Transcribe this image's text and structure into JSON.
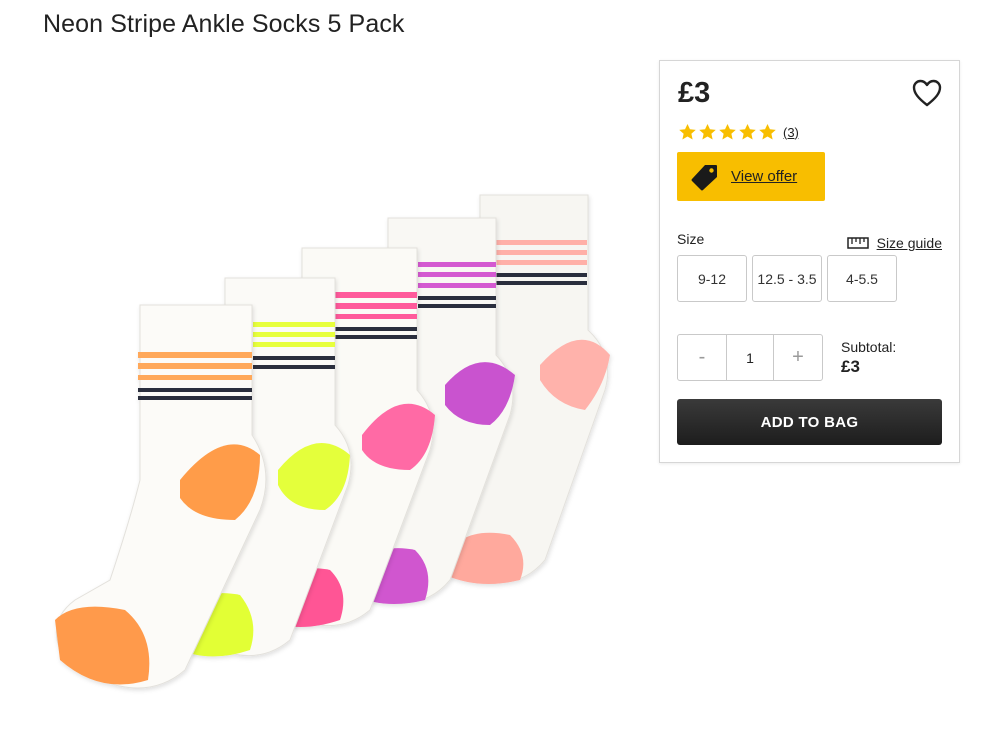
{
  "product": {
    "title": "Neon Stripe Ankle Socks 5 Pack",
    "image_icon": "socks-5pack-image"
  },
  "panel": {
    "price": "£3",
    "wishlist_icon": "heart-outline-icon",
    "rating": {
      "stars": 5,
      "max": 5,
      "count_label": "(3)",
      "star_color": "#f8be00"
    },
    "offer": {
      "icon": "price-tag-icon",
      "label": "View offer",
      "color": "#f8be00"
    },
    "size": {
      "label": "Size",
      "guide_icon": "ruler-icon",
      "guide_label": "Size guide",
      "options": [
        "9-12",
        "12.5 - 3.5",
        "4-5.5"
      ]
    },
    "quantity": {
      "minus": "-",
      "value": "1",
      "plus": "+"
    },
    "subtotal": {
      "label": "Subtotal:",
      "value": "£3"
    },
    "add_to_bag": "ADD TO BAG"
  }
}
